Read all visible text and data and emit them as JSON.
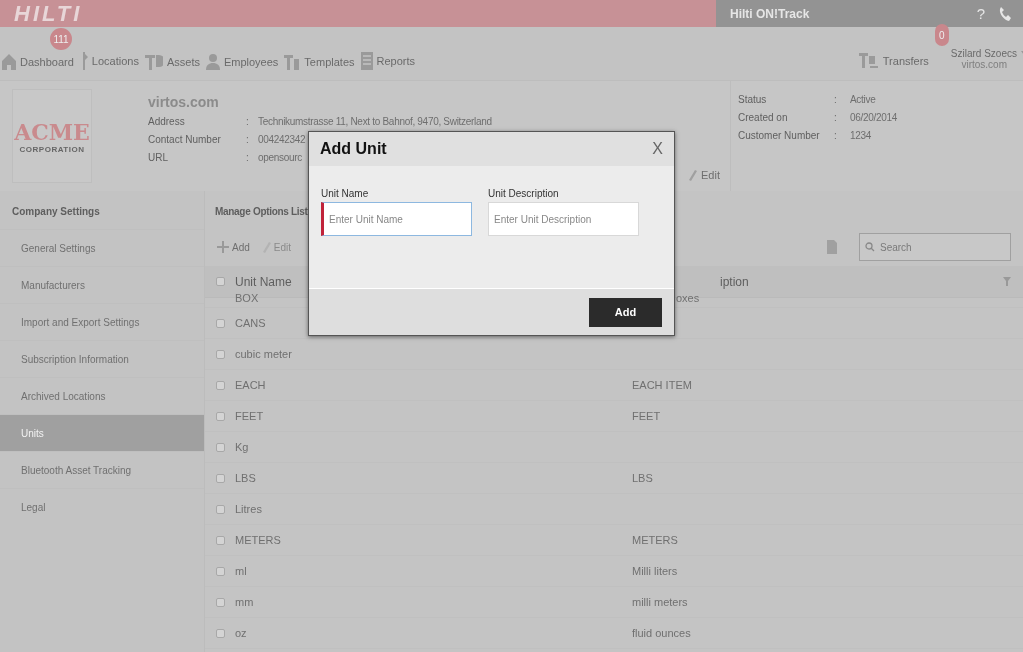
{
  "top_bar": {
    "logo": "HILTI",
    "app_title": "Hilti ON!Track",
    "help": "?"
  },
  "nav": {
    "items": [
      {
        "label": "Dashboard",
        "badge": "111"
      },
      {
        "label": "Locations"
      },
      {
        "label": "Assets"
      },
      {
        "label": "Employees"
      },
      {
        "label": "Templates"
      },
      {
        "label": "Reports"
      }
    ],
    "transfers": {
      "label": "Transfers",
      "badge": "0"
    },
    "user": {
      "name": "Szilard Szoecs",
      "company": "virtos.com"
    }
  },
  "company": {
    "logo_top": "ACME",
    "logo_bottom": "CORPORATION",
    "name": "virtos.com",
    "fields": [
      {
        "label": "Address",
        "separator": ":",
        "value": "Technikumstrasse 11, Next to Bahnof, 9470, Switzerland"
      },
      {
        "label": "Contact Number",
        "separator": ":",
        "value": "004242342"
      },
      {
        "label": "URL",
        "separator": ":",
        "value": "opensourc"
      }
    ],
    "edit": "Edit",
    "status_fields": [
      {
        "label": "Status",
        "separator": ":",
        "value": "Active"
      },
      {
        "label": "Created on",
        "separator": ":",
        "value": "06/20/2014"
      },
      {
        "label": "Customer Number",
        "separator": ":",
        "value": "1234"
      }
    ]
  },
  "sidebar": {
    "title": "Company Settings",
    "items": [
      {
        "label": "General Settings",
        "selected": false
      },
      {
        "label": "Manufacturers",
        "selected": false
      },
      {
        "label": "Import and Export Settings",
        "selected": false
      },
      {
        "label": "Subscription Information",
        "selected": false
      },
      {
        "label": "Archived Locations",
        "selected": false
      },
      {
        "label": "Units",
        "selected": true
      },
      {
        "label": "Bluetooth Asset Tracking",
        "selected": false
      },
      {
        "label": "Legal",
        "selected": false
      }
    ]
  },
  "main": {
    "title": "Manage Options List",
    "toolbar": {
      "add": "Add",
      "edit": "Edit",
      "search_placeholder": "Search"
    },
    "table": {
      "columns": [
        "Unit Name",
        "iption"
      ],
      "all_checked": false,
      "rows": [
        {
          "name": "BOX",
          "description": "oxes"
        },
        {
          "name": "CANS",
          "checked": false
        },
        {
          "name": "cubic meter",
          "checked": false
        },
        {
          "name": "EACH",
          "description": "EACH ITEM",
          "checked": false
        },
        {
          "name": "FEET",
          "description": "FEET",
          "checked": false
        },
        {
          "name": "Kg",
          "checked": false
        },
        {
          "name": "LBS",
          "description": "LBS",
          "checked": false
        },
        {
          "name": "Litres",
          "checked": false
        },
        {
          "name": "METERS",
          "description": "METERS",
          "checked": false
        },
        {
          "name": "ml",
          "description": "Milli liters",
          "checked": false
        },
        {
          "name": "mm",
          "description": "milli meters",
          "checked": false
        },
        {
          "name": "oz",
          "description": "fluid ounces",
          "checked": false
        }
      ]
    }
  },
  "dialog": {
    "title": "Add Unit",
    "close": "X",
    "fields": [
      {
        "label": "Unit Name",
        "placeholder": "Enter Unit Name",
        "focused": true
      },
      {
        "label": "Unit Description",
        "placeholder": "Enter Unit Description",
        "focused": false
      }
    ],
    "button": "Add"
  }
}
